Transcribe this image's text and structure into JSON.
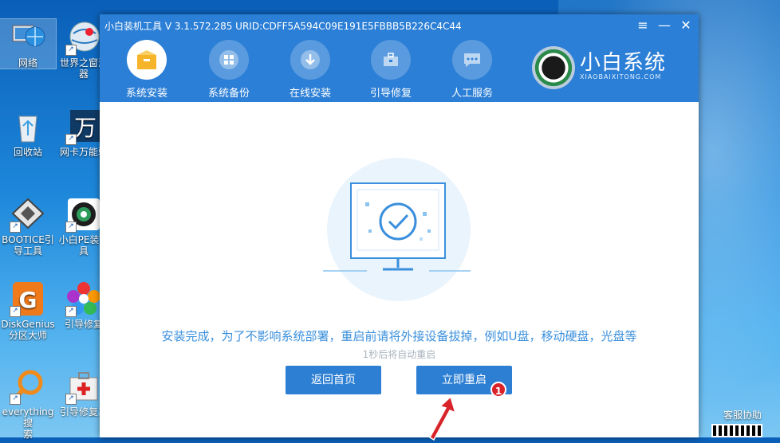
{
  "desktop": {
    "icons": [
      {
        "name": "network",
        "label": "网络"
      },
      {
        "name": "browser",
        "label": "世界之窗浏\n器"
      },
      {
        "name": "recycle-bin",
        "label": "回收站"
      },
      {
        "name": "netcard",
        "label": "网卡万能驱"
      },
      {
        "name": "bootice",
        "label": "BOOTICE引\n导工具"
      },
      {
        "name": "xiaobai-pe",
        "label": "小白PE装机\n具"
      },
      {
        "name": "diskgenius",
        "label": "DiskGenius\n分区大师"
      },
      {
        "name": "boot-repair",
        "label": "引导修复"
      },
      {
        "name": "everything",
        "label": "everything搜\n索"
      },
      {
        "name": "boot-repair-tool",
        "label": "引导修复工"
      }
    ],
    "support_label": "客服协助"
  },
  "window": {
    "title": "小白装机工具 V 3.1.572.285 URID:CDFF5A594C09E191E5FBBB5B226C4C44",
    "controls": {
      "menu": "≡",
      "minimize": "—",
      "close": "✕"
    },
    "nav": [
      {
        "label": "系统安装",
        "icon": "box-icon"
      },
      {
        "label": "系统备份",
        "icon": "windows-icon"
      },
      {
        "label": "在线安装",
        "icon": "download-icon"
      },
      {
        "label": "引导修复",
        "icon": "toolbox-icon"
      },
      {
        "label": "人工服务",
        "icon": "chat-icon"
      }
    ],
    "brand": {
      "name": "小白系统",
      "sub": "XIAOBAIXITONG.COM"
    }
  },
  "main": {
    "message": "安装完成，为了不影响系统部署，重启前请将外接设备拔掉，例如U盘，移动硬盘，光盘等",
    "countdown": "1秒后将自动重启",
    "back_button": "返回首页",
    "restart_button": "立即重启",
    "annotation_badge": "1"
  },
  "colors": {
    "accent": "#2c7fd6",
    "text_blue": "#3a8fdc",
    "badge_red": "#d9232a"
  }
}
